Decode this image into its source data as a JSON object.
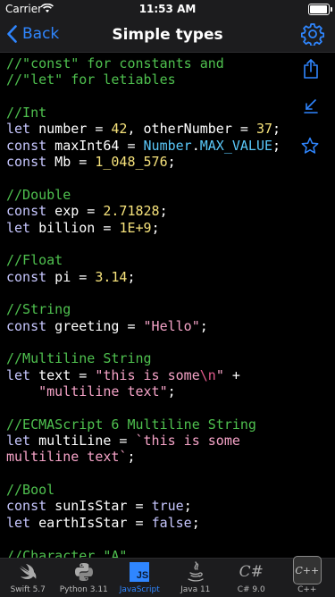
{
  "status": {
    "carrier": "Carrier",
    "time": "11:53 AM"
  },
  "nav": {
    "back_label": "Back",
    "title": "Simple types"
  },
  "code_lines": [
    [
      {
        "c": "cm",
        "t": "//\"const\" for constants and"
      }
    ],
    [
      {
        "c": "cm",
        "t": "//\"let\" for letiables"
      }
    ],
    [],
    [
      {
        "c": "cm",
        "t": "//Int"
      }
    ],
    [
      {
        "c": "kw",
        "t": "let"
      },
      {
        "c": "pl",
        "t": " number = "
      },
      {
        "c": "nm",
        "t": "42"
      },
      {
        "c": "pl",
        "t": ", otherNumber = "
      },
      {
        "c": "nm",
        "t": "37"
      },
      {
        "c": "pl",
        "t": ";"
      }
    ],
    [
      {
        "c": "kw",
        "t": "const"
      },
      {
        "c": "pl",
        "t": " maxInt64 = "
      },
      {
        "c": "cl",
        "t": "Number"
      },
      {
        "c": "pl",
        "t": "."
      },
      {
        "c": "cl",
        "t": "MAX_VALUE"
      },
      {
        "c": "pl",
        "t": ";"
      }
    ],
    [
      {
        "c": "kw",
        "t": "const"
      },
      {
        "c": "pl",
        "t": " Mb = "
      },
      {
        "c": "nm",
        "t": "1_048_576"
      },
      {
        "c": "pl",
        "t": ";"
      }
    ],
    [],
    [
      {
        "c": "cm",
        "t": "//Double"
      }
    ],
    [
      {
        "c": "kw",
        "t": "const"
      },
      {
        "c": "pl",
        "t": " exp = "
      },
      {
        "c": "nm",
        "t": "2.71828"
      },
      {
        "c": "pl",
        "t": ";"
      }
    ],
    [
      {
        "c": "kw",
        "t": "let"
      },
      {
        "c": "pl",
        "t": " billion = "
      },
      {
        "c": "nm",
        "t": "1E+9"
      },
      {
        "c": "pl",
        "t": ";"
      }
    ],
    [],
    [
      {
        "c": "cm",
        "t": "//Float"
      }
    ],
    [
      {
        "c": "kw",
        "t": "const"
      },
      {
        "c": "pl",
        "t": " pi = "
      },
      {
        "c": "nm",
        "t": "3.14"
      },
      {
        "c": "pl",
        "t": ";"
      }
    ],
    [],
    [
      {
        "c": "cm",
        "t": "//String"
      }
    ],
    [
      {
        "c": "kw",
        "t": "const"
      },
      {
        "c": "pl",
        "t": " greeting = "
      },
      {
        "c": "st",
        "t": "\"Hello\""
      },
      {
        "c": "pl",
        "t": ";"
      }
    ],
    [],
    [
      {
        "c": "cm",
        "t": "//Multiline String"
      }
    ],
    [
      {
        "c": "kw",
        "t": "let"
      },
      {
        "c": "pl",
        "t": " text = "
      },
      {
        "c": "st",
        "t": "\"this is some"
      },
      {
        "c": "es",
        "t": "\\n"
      },
      {
        "c": "st",
        "t": "\""
      },
      {
        "c": "pl",
        "t": " +"
      }
    ],
    [
      {
        "c": "pl",
        "t": "    "
      },
      {
        "c": "st",
        "t": "\"multiline text\""
      },
      {
        "c": "pl",
        "t": ";"
      }
    ],
    [],
    [
      {
        "c": "cm",
        "t": "//ECMAScript 6 Multiline String"
      }
    ],
    [
      {
        "c": "kw",
        "t": "let"
      },
      {
        "c": "pl",
        "t": " multiLine = "
      },
      {
        "c": "st",
        "t": "`this is some"
      }
    ],
    [
      {
        "c": "st",
        "t": "multiline text`"
      },
      {
        "c": "pl",
        "t": ";"
      }
    ],
    [],
    [
      {
        "c": "cm",
        "t": "//Bool"
      }
    ],
    [
      {
        "c": "kw",
        "t": "const"
      },
      {
        "c": "pl",
        "t": " sunIsStar = "
      },
      {
        "c": "kw",
        "t": "true"
      },
      {
        "c": "pl",
        "t": ";"
      }
    ],
    [
      {
        "c": "kw",
        "t": "let"
      },
      {
        "c": "pl",
        "t": " earthIsStar = "
      },
      {
        "c": "kw",
        "t": "false"
      },
      {
        "c": "pl",
        "t": ";"
      }
    ],
    [],
    [
      {
        "c": "cm",
        "t": "//Character \"A\""
      }
    ]
  ],
  "tabs": [
    {
      "label": "Swift 5.7",
      "icon": "swift-icon"
    },
    {
      "label": "Python 3.11",
      "icon": "python-icon"
    },
    {
      "label": "JavaScript",
      "icon": "javascript-icon",
      "badge": "JS",
      "active": true
    },
    {
      "label": "Java 11",
      "icon": "java-icon"
    },
    {
      "label": "C# 9.0",
      "icon": "csharp-icon",
      "badge": "C#"
    },
    {
      "label": "C++",
      "icon": "cpp-icon",
      "badge": "C++"
    }
  ]
}
